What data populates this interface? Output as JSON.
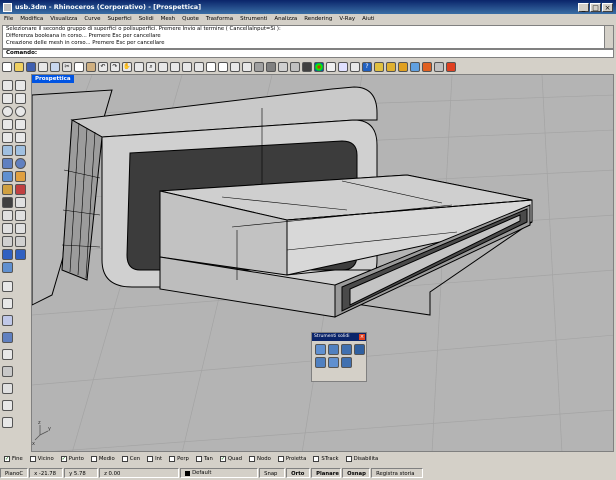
{
  "window": {
    "title": "usb.3dm - Rhinoceros (Corporativo) - [Prospettica]"
  },
  "menu": [
    "File",
    "Modifica",
    "Visualizza",
    "Curve",
    "Superfici",
    "Solidi",
    "Mesh",
    "Quote",
    "Trasforma",
    "Strumenti",
    "Analizza",
    "Rendering",
    "V-Ray",
    "Aiuti"
  ],
  "history": [
    "Selezionare il secondo gruppo di superfici o polisuperfici. Premere Invio al termine ( CancellaInput=Sì ):",
    "Differenza booleana in corso... Premere Esc per cancellare",
    "Creazione delle mesh in corso... Premere Esc per cancellare"
  ],
  "command": {
    "label": "Comando:"
  },
  "viewport": {
    "name": "Prospettica"
  },
  "floating": {
    "title": "Strumenti solidi"
  },
  "osnaps": [
    {
      "label": "Fine",
      "checked": true
    },
    {
      "label": "Vicino",
      "checked": false
    },
    {
      "label": "Punto",
      "checked": true
    },
    {
      "label": "Medio",
      "checked": false
    },
    {
      "label": "Cen",
      "checked": false
    },
    {
      "label": "Int",
      "checked": false
    },
    {
      "label": "Perp",
      "checked": false
    },
    {
      "label": "Tan",
      "checked": false
    },
    {
      "label": "Quad",
      "checked": true
    },
    {
      "label": "Nodo",
      "checked": false
    },
    {
      "label": "Proietta",
      "checked": false
    },
    {
      "label": "STrack",
      "checked": false
    },
    {
      "label": "Disabilita",
      "checked": false
    }
  ],
  "status": {
    "cplane": "PianoC",
    "x": "x -21.78",
    "y": "y 5.78",
    "z": "z 0.00",
    "layer": "Default",
    "snap": "Snap",
    "orto": "Orto",
    "planare": "Planare",
    "osnap": "Osnap",
    "history": "Registra storia"
  },
  "axis_labels": {
    "z": "z",
    "y": "y",
    "x": "x"
  },
  "colors": {
    "titlebar": "#0a246a",
    "viewport_bg": "#b4b4b4",
    "accent": "#0054e3"
  }
}
